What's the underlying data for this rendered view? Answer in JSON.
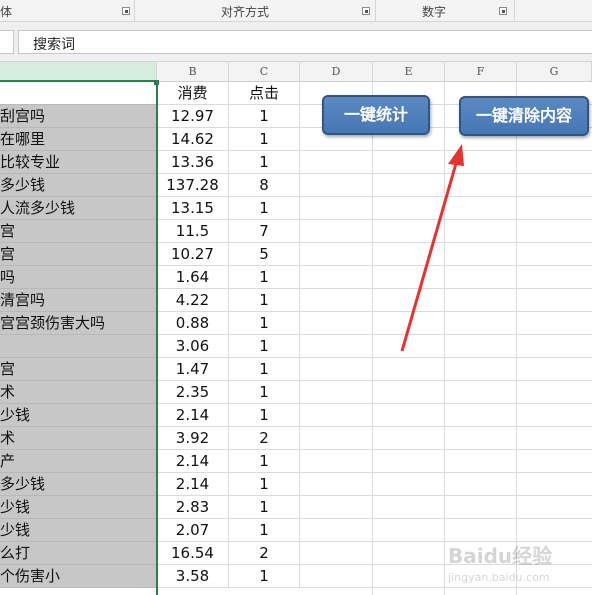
{
  "ribbon": {
    "groups": [
      {
        "label": "体"
      },
      {
        "label": "对齐方式"
      },
      {
        "label": "数字"
      }
    ]
  },
  "formula_bar": {
    "value": "搜索词"
  },
  "columns": [
    "",
    "B",
    "C",
    "D",
    "E",
    "F",
    "G"
  ],
  "table": {
    "headers": [
      "",
      "消费",
      "点击"
    ],
    "rows": [
      {
        "a": "刮宫吗",
        "b": "12.97",
        "c": "1"
      },
      {
        "a": "在哪里",
        "b": "14.62",
        "c": "1"
      },
      {
        "a": "比较专业",
        "b": "13.36",
        "c": "1"
      },
      {
        "a": "多少钱",
        "b": "137.28",
        "c": "8"
      },
      {
        "a": "人流多少钱",
        "b": "13.15",
        "c": "1"
      },
      {
        "a": "宫",
        "b": "11.5",
        "c": "7"
      },
      {
        "a": "宫",
        "b": "10.27",
        "c": "5"
      },
      {
        "a": "吗",
        "b": "1.64",
        "c": "1"
      },
      {
        "a": "清宫吗",
        "b": "4.22",
        "c": "1"
      },
      {
        "a": "宫宫颈伤害大吗",
        "b": "0.88",
        "c": "1"
      },
      {
        "a": "",
        "b": "3.06",
        "c": "1"
      },
      {
        "a": "宫",
        "b": "1.47",
        "c": "1"
      },
      {
        "a": "术",
        "b": "2.35",
        "c": "1"
      },
      {
        "a": "少钱",
        "b": "2.14",
        "c": "1"
      },
      {
        "a": "术",
        "b": "3.92",
        "c": "2"
      },
      {
        "a": "产",
        "b": "2.14",
        "c": "1"
      },
      {
        "a": "多少钱",
        "b": "2.14",
        "c": "1"
      },
      {
        "a": "少钱",
        "b": "2.83",
        "c": "1"
      },
      {
        "a": "少钱",
        "b": "2.07",
        "c": "1"
      },
      {
        "a": "么打",
        "b": "16.54",
        "c": "2"
      },
      {
        "a": "个伤害小",
        "b": "3.58",
        "c": "1"
      }
    ]
  },
  "buttons": {
    "stats": "一键统计",
    "clear": "一键清除内容"
  },
  "watermark": {
    "brand": "Baidu经验",
    "url": "jingyan.baidu.com"
  },
  "colors": {
    "macro_button": "#4a7ab8",
    "selection": "#2e7d4f",
    "column_a_fill": "#c7c7c7",
    "arrow": "#e8322e"
  }
}
